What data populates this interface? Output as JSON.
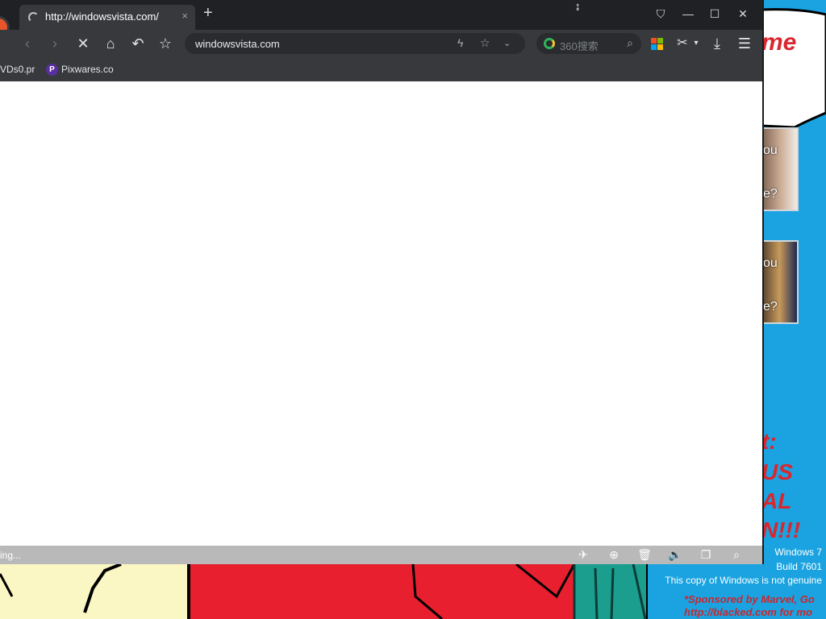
{
  "browser": {
    "tab": {
      "title": "http://windowsvista.com/",
      "close_label": "×"
    },
    "new_tab_label": "+",
    "cursor_glyph": "↨",
    "window_controls": {
      "skin": "⛉",
      "minimize": "—",
      "maximize": "☐",
      "close": "✕"
    },
    "toolbar": {
      "back": "‹",
      "forward": "›",
      "stop": "✕",
      "home": "⌂",
      "undo": "↶",
      "favorite": "☆",
      "address": "windowsvista.com",
      "address_icons": {
        "accelerate": "ϟ",
        "star": "☆",
        "dropdown": "⌄"
      },
      "search_engine_text": "360搜索",
      "search_icon": "⌕",
      "scissor": "✂",
      "caret": "▾",
      "download": "⤓",
      "menu": "☰"
    },
    "bookmarks": [
      {
        "label": "VDs0.pr"
      },
      {
        "icon_letter": "P",
        "label": "Pixwares.co"
      }
    ],
    "status": {
      "text": "ing..."
    },
    "status_icons": [
      "rocket-icon",
      "refresh-circle-icon",
      "trash-icon",
      "speaker-icon",
      "window-icon",
      "search-icon"
    ],
    "status_glyphs": [
      "✈",
      "⊕",
      "🗑",
      "🔈",
      "❐",
      "⌕"
    ]
  },
  "desktop": {
    "partial_text_top": "me",
    "photos": [
      {
        "line1": "ou",
        "line2": "e?"
      },
      {
        "line1": "ou",
        "line2": "e?"
      }
    ],
    "partial_lines": [
      "t:",
      "US",
      "AL",
      "N!!!"
    ],
    "watermark": {
      "line1": "Windows 7",
      "line2": "Build 7601",
      "line3": "This copy of Windows is not genuine"
    },
    "sponsor": {
      "line1": "*Sponsored by Marvel, Go",
      "line2": "http://blacked.com for mo"
    }
  },
  "colors": {
    "desktop_bg": "#1aa3e0",
    "wallpaper_red": "#d9262f",
    "browser_dark": "#38393c",
    "titlebar": "#202124",
    "statusbar": "#b9b9b9",
    "ms_logo": [
      "#f25022",
      "#7fba00",
      "#00a4ef",
      "#ffb900"
    ]
  }
}
